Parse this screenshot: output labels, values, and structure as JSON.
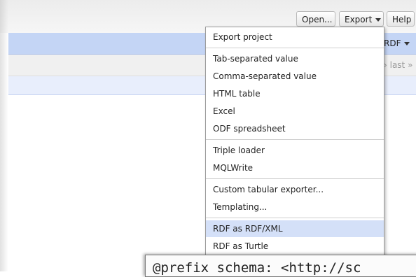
{
  "toolbar": {
    "open_label": "Open...",
    "export_label": "Export",
    "help_label": "Help"
  },
  "tab_label": "RDF",
  "pager_text": "› last »",
  "export_menu": {
    "items": [
      "Export project",
      "Tab-separated value",
      "Comma-separated value",
      "HTML table",
      "Excel",
      "ODF spreadsheet",
      "Triple loader",
      "MQLWrite",
      "Custom tabular exporter...",
      "Templating...",
      "RDF as RDF/XML",
      "RDF as Turtle"
    ],
    "highlighted_item": "RDF as RDF/XML"
  },
  "code_preview": "@prefix schema: <http://sc",
  "colors": {
    "header_blue": "#c4d5f5",
    "menu_highlight": "#d4e0f8"
  }
}
